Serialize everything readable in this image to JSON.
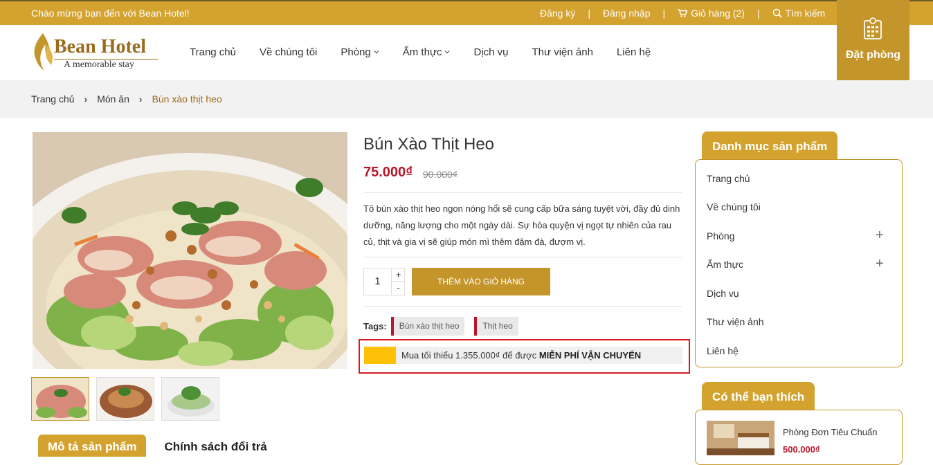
{
  "topbar": {
    "welcome": "Chào mừng bạn đến với Bean Hotel!",
    "register": "Đăng ký",
    "login": "Đăng nhập",
    "cart": "Giỏ hàng (2)",
    "search": "Tìm kiếm",
    "separator": "|"
  },
  "booking": {
    "label": "Đặt phòng",
    "icon": "calendar-icon"
  },
  "logo": {
    "name": "Bean Hotel",
    "slogan": "A memorable stay"
  },
  "nav": [
    {
      "label": "Trang chủ"
    },
    {
      "label": "Về chúng tôi"
    },
    {
      "label": "Phòng"
    },
    {
      "label": "Ẩm thực"
    },
    {
      "label": "Dịch vụ"
    },
    {
      "label": "Thư viện ảnh"
    },
    {
      "label": "Liên hệ"
    }
  ],
  "breadcrumb": {
    "home": "Trang chủ",
    "category": "Món ăn",
    "current": "Bún xào thịt heo",
    "arrow": "›"
  },
  "product": {
    "title": "Bún Xào Thịt Heo",
    "price": "75.000₫",
    "old_price": "90.000₫",
    "description": "Tô bún xào thịt heo ngon nóng hổi sẽ cung cấp bữa sáng tuyệt vời, đầy đủ dinh dưỡng, năng lượng cho một ngày dài. Sự hòa quyện vị ngọt tự nhiên của rau củ, thịt và gia vị sẽ giúp món mì thêm đậm đà, đượm vị.",
    "quantity": "1",
    "plus": "+",
    "minus": "-",
    "add_to_cart": "THÊM VÀO GIỎ HÀNG",
    "tags_label": "Tags:",
    "tags": [
      "Bún xào thịt heo",
      "Thịt heo"
    ]
  },
  "shipping": {
    "text": "Mua tối thiểu 1.355.000₫ để được ",
    "highlight": "MIỄN PHÍ VẬN CHUYỂN",
    "progress": 0.1,
    "bar_color": "#ffc107"
  },
  "tabs": {
    "description": "Mô tả sản phẩm",
    "return_policy": "Chính sách đổi trả"
  },
  "sidebar": {
    "category_title": "Danh mục sản phẩm",
    "categories": [
      {
        "label": "Trang chủ",
        "expand": ""
      },
      {
        "label": "Về chúng tôi",
        "expand": ""
      },
      {
        "label": "Phòng",
        "expand": "+"
      },
      {
        "label": "Ẩm thực",
        "expand": "+"
      },
      {
        "label": "Dịch vụ",
        "expand": ""
      },
      {
        "label": "Thư viện ảnh",
        "expand": ""
      },
      {
        "label": "Liên hệ",
        "expand": ""
      }
    ],
    "recommend_title": "Có thể bạn thích",
    "recommend": {
      "name": "Phòng Đơn Tiêu Chuẩn",
      "price": "500.000₫"
    }
  },
  "colors": {
    "brand": "#d4a22e",
    "price": "#b8162a",
    "highlight_border": "#d71a21"
  }
}
